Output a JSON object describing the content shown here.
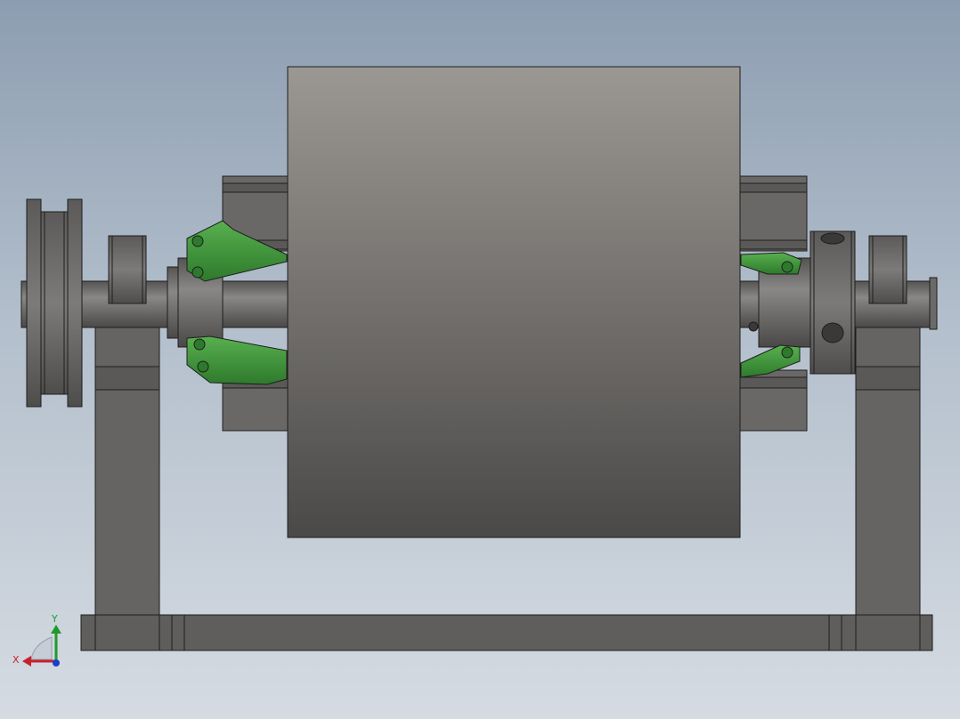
{
  "viewport": {
    "background_top": "#8d9db1",
    "background_bottom": "#d5dbe2"
  },
  "colors": {
    "steel_dark": "#4f4e4d",
    "steel_mid": "#666462",
    "steel_light": "#7a7876",
    "drum_top": "#9b9893",
    "drum_bottom": "#4b4948",
    "linkage_green": "#3c8f3a",
    "linkage_green_dark": "#1f5a20",
    "edge": "#1e1e1e"
  },
  "triad": {
    "x_label": "X",
    "y_label": "Y",
    "x_color": "#c8202a",
    "y_color": "#1d9a2b",
    "z_color": "#1a3fc9"
  }
}
